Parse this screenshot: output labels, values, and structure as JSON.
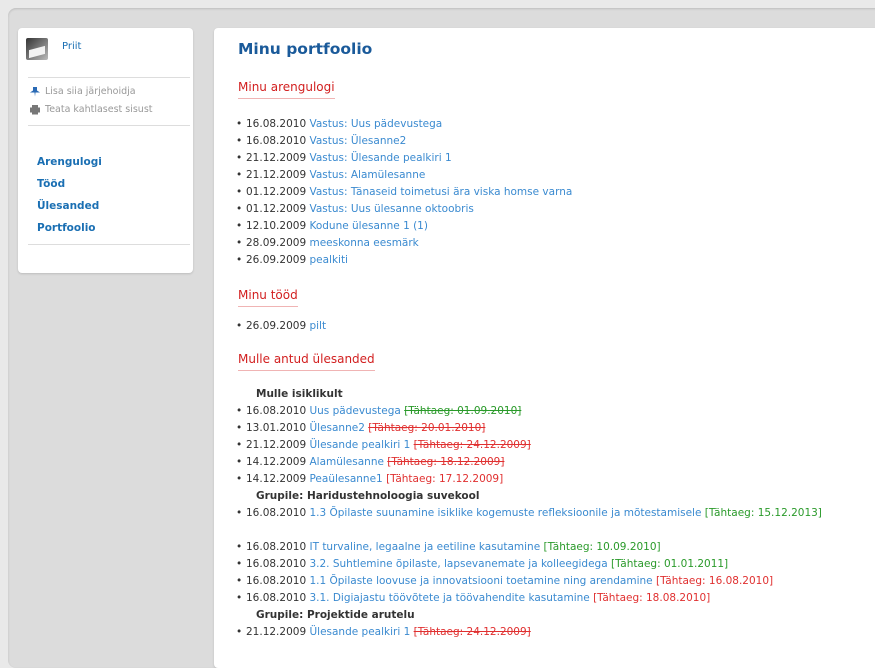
{
  "sidebar": {
    "user": "Priit",
    "tools": [
      "Lisa siia järjehoidja",
      "Teata kahtlasest sisust"
    ],
    "nav": [
      "Arengulogi",
      "Tööd",
      "Ülesanded",
      "Portfoolio"
    ]
  },
  "main": {
    "title": "Minu portfoolio",
    "s1": {
      "title": "Minu arengulogi",
      "items": [
        {
          "date": "16.08.2010",
          "link": "Vastus: Uus pädevustega"
        },
        {
          "date": "16.08.2010",
          "link": "Vastus: Ülesanne2"
        },
        {
          "date": "21.12.2009",
          "link": "Vastus: Ülesande pealkiri 1"
        },
        {
          "date": "21.12.2009",
          "link": "Vastus: Alamülesanne"
        },
        {
          "date": "01.12.2009",
          "link": "Vastus: Tänaseid toimetusi ära viska homse varna"
        },
        {
          "date": "01.12.2009",
          "link": "Vastus: Uus ülesanne oktoobris"
        },
        {
          "date": "12.10.2009",
          "link": "Kodune ülesanne 1 (1)"
        },
        {
          "date": "28.09.2009",
          "link": "meeskonna eesmärk"
        },
        {
          "date": "26.09.2009",
          "link": "pealkiti"
        }
      ]
    },
    "s2": {
      "title": "Minu tööd",
      "items": [
        {
          "date": "26.09.2009",
          "link": "pilt"
        }
      ]
    },
    "s3": {
      "title": "Mulle antud ülesanded",
      "g1": "Mulle isiklikult",
      "g2": "Grupile: Haridustehnoloogia suvekool",
      "g3": "Grupile: Projektide arutelu",
      "items": [
        {
          "date": "16.08.2010",
          "link": "Uus pädevustega",
          "deadline": "[Tähtaeg: 01.09.2010]"
        },
        {
          "date": "13.01.2010",
          "link": "Ülesanne2",
          "deadline": "[Tähtaeg: 20.01.2010]"
        },
        {
          "date": "21.12.2009",
          "link": "Ülesande pealkiri 1",
          "deadline": "[Tähtaeg: 24.12.2009]"
        },
        {
          "date": "14.12.2009",
          "link": "Alamülesanne",
          "deadline": "[Tähtaeg: 18.12.2009]"
        },
        {
          "date": "14.12.2009",
          "link": "Peaülesanne1",
          "deadline": "[Tähtaeg: 17.12.2009]"
        },
        {
          "date": "16.08.2010",
          "link": "1.3 Õpilaste suunamine isiklike kogemuste refleksioonile ja mõtestamisele",
          "deadline": "[Tähtaeg: 15.12.2013]"
        },
        {
          "date": "16.08.2010",
          "link": "IT turvaline, legaalne ja eetiline kasutamine",
          "deadline": "[Tähtaeg: 10.09.2010]"
        },
        {
          "date": "16.08.2010",
          "link": "3.2. Suhtlemine õpilaste, lapsevanemate ja kolleegidega",
          "deadline": "[Tähtaeg: 01.01.2011]"
        },
        {
          "date": "16.08.2010",
          "link": "1.1 Õpilaste loovuse ja innovatsiooni toetamine ning arendamine",
          "deadline": "[Tähtaeg: 16.08.2010]"
        },
        {
          "date": "16.08.2010",
          "link": "3.1. Digiajastu töövõtete ja töövahendite kasutamine",
          "deadline": "[Tähtaeg: 18.08.2010]"
        },
        {
          "date": "21.12.2009",
          "link": "Ülesande pealkiri 1",
          "deadline": "[Tähtaeg: 24.12.2009]"
        }
      ]
    }
  },
  "colors": {
    "link": "#3a8ad0",
    "heading": "#d21f1f",
    "deadline_ok": "#2a9a2a",
    "deadline_late": "#e03030"
  }
}
